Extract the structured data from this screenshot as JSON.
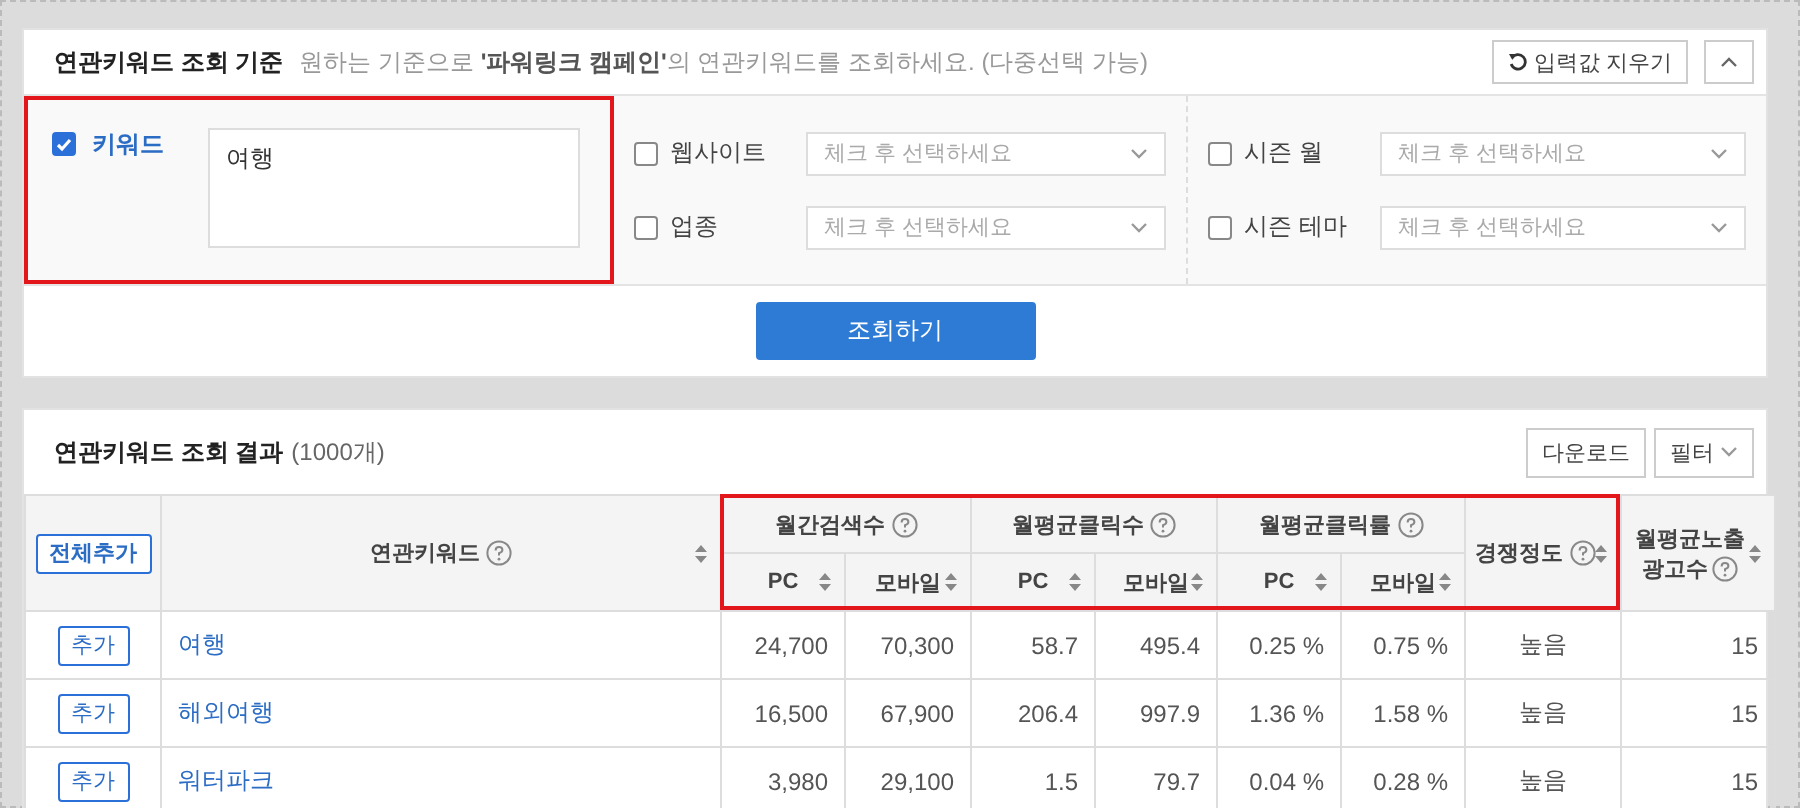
{
  "criteria_panel": {
    "title": "연관키워드 조회 기준",
    "subtitle": "원하는 기준으로 **'파워링크 캠페인'**의 연관키워드를 조회하세요. (다중선택 가능)",
    "reset_button": "입력값 지우기",
    "keyword": {
      "label": "키워드",
      "checked": true,
      "value": "여행",
      "highlighted": true
    },
    "filters": [
      {
        "label": "웹사이트",
        "checked": false,
        "placeholder": "체크 후 선택하세요"
      },
      {
        "label": "시즌 월",
        "checked": false,
        "placeholder": "체크 후 선택하세요"
      },
      {
        "label": "업종",
        "checked": false,
        "placeholder": "체크 후 선택하세요"
      },
      {
        "label": "시즌 테마",
        "checked": false,
        "placeholder": "체크 후 선택하세요"
      }
    ],
    "search_button": "조회하기"
  },
  "results_panel": {
    "title": "연관키워드 조회 결과",
    "count": "(1000개)",
    "download_button": "다운로드",
    "filter_button": "필터",
    "table": {
      "add_all_button": "전체추가",
      "keyword_column": "연관키워드",
      "metrics_highlighted": true,
      "groups": [
        {
          "label": "월간검색수",
          "sub": [
            "PC",
            "모바일"
          ]
        },
        {
          "label": "월평균클릭수",
          "sub": [
            "PC",
            "모바일"
          ]
        },
        {
          "label": "월평균클릭률",
          "sub": [
            "PC",
            "모바일"
          ]
        }
      ],
      "competition_column": {
        "label": "경쟁정도"
      },
      "impressions_column": [
        "월평균노출",
        "광고수"
      ],
      "rows": [
        {
          "add_button": "추가",
          "keyword": "여행",
          "values": [
            "24,700",
            "70,300",
            "58.7",
            "495.4",
            "0.25 %",
            "0.75 %"
          ],
          "competition": "높음",
          "impressions": "15"
        },
        {
          "add_button": "추가",
          "keyword": "해외여행",
          "values": [
            "16,500",
            "67,900",
            "206.4",
            "997.9",
            "1.36 %",
            "1.58 %"
          ],
          "competition": "높음",
          "impressions": "15"
        },
        {
          "add_button": "추가",
          "keyword": "워터파크",
          "values": [
            "3,980",
            "29,100",
            "1.5",
            "79.7",
            "0.04 %",
            "0.28 %"
          ],
          "competition": "높음",
          "impressions": "15"
        }
      ]
    }
  }
}
